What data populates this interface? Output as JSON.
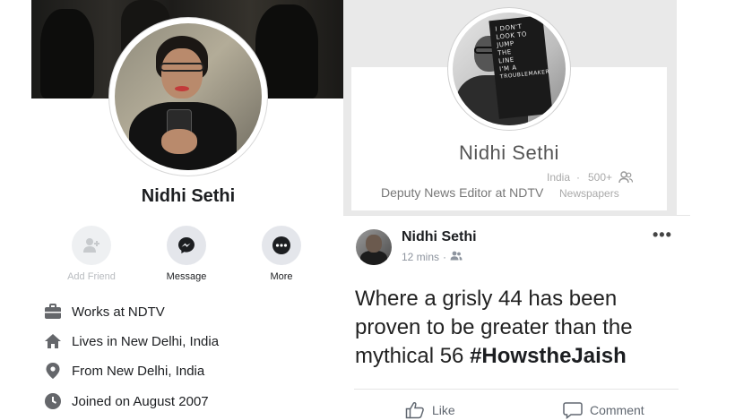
{
  "left_profile": {
    "name": "Nidhi Sethi",
    "actions": [
      {
        "label": "Add Friend",
        "icon": "add-friend-icon",
        "enabled": false
      },
      {
        "label": "Message",
        "icon": "messenger-icon",
        "enabled": true
      },
      {
        "label": "More",
        "icon": "more-icon",
        "enabled": true
      }
    ],
    "info": [
      {
        "prefix": "Works at",
        "value": "NDTV",
        "icon": "briefcase-icon"
      },
      {
        "prefix": "Lives in",
        "value": "New Delhi, India",
        "icon": "home-icon"
      },
      {
        "prefix": "From",
        "value": "New Delhi, India",
        "icon": "location-pin-icon"
      },
      {
        "prefix": "Joined on August 2007",
        "value": "",
        "icon": "clock-icon"
      }
    ]
  },
  "right_profile": {
    "name": "Nidhi Sethi",
    "job": "Deputy News Editor at NDTV",
    "country": "India",
    "separator": "·",
    "members": "500+",
    "category": "Newspapers",
    "avatar_book_text": [
      "I DON'T",
      "LOOK TO",
      "JUMP",
      "THE",
      "LINE",
      "I'M A",
      "TROUBLEMAKER"
    ]
  },
  "post": {
    "author": "Nidhi Sethi",
    "time": "12 mins",
    "separator": "·",
    "more": "•••",
    "text_main": "Where a grisly 44 has been proven to be greater than the mythical 56 ",
    "hashtag": "#HowstheJaish",
    "like_label": "Like",
    "comment_label": "Comment"
  },
  "colors": {
    "icon_gray": "#65676b",
    "disabled_gray": "#c7cacd",
    "panel_bg": "#e9e9e9"
  }
}
